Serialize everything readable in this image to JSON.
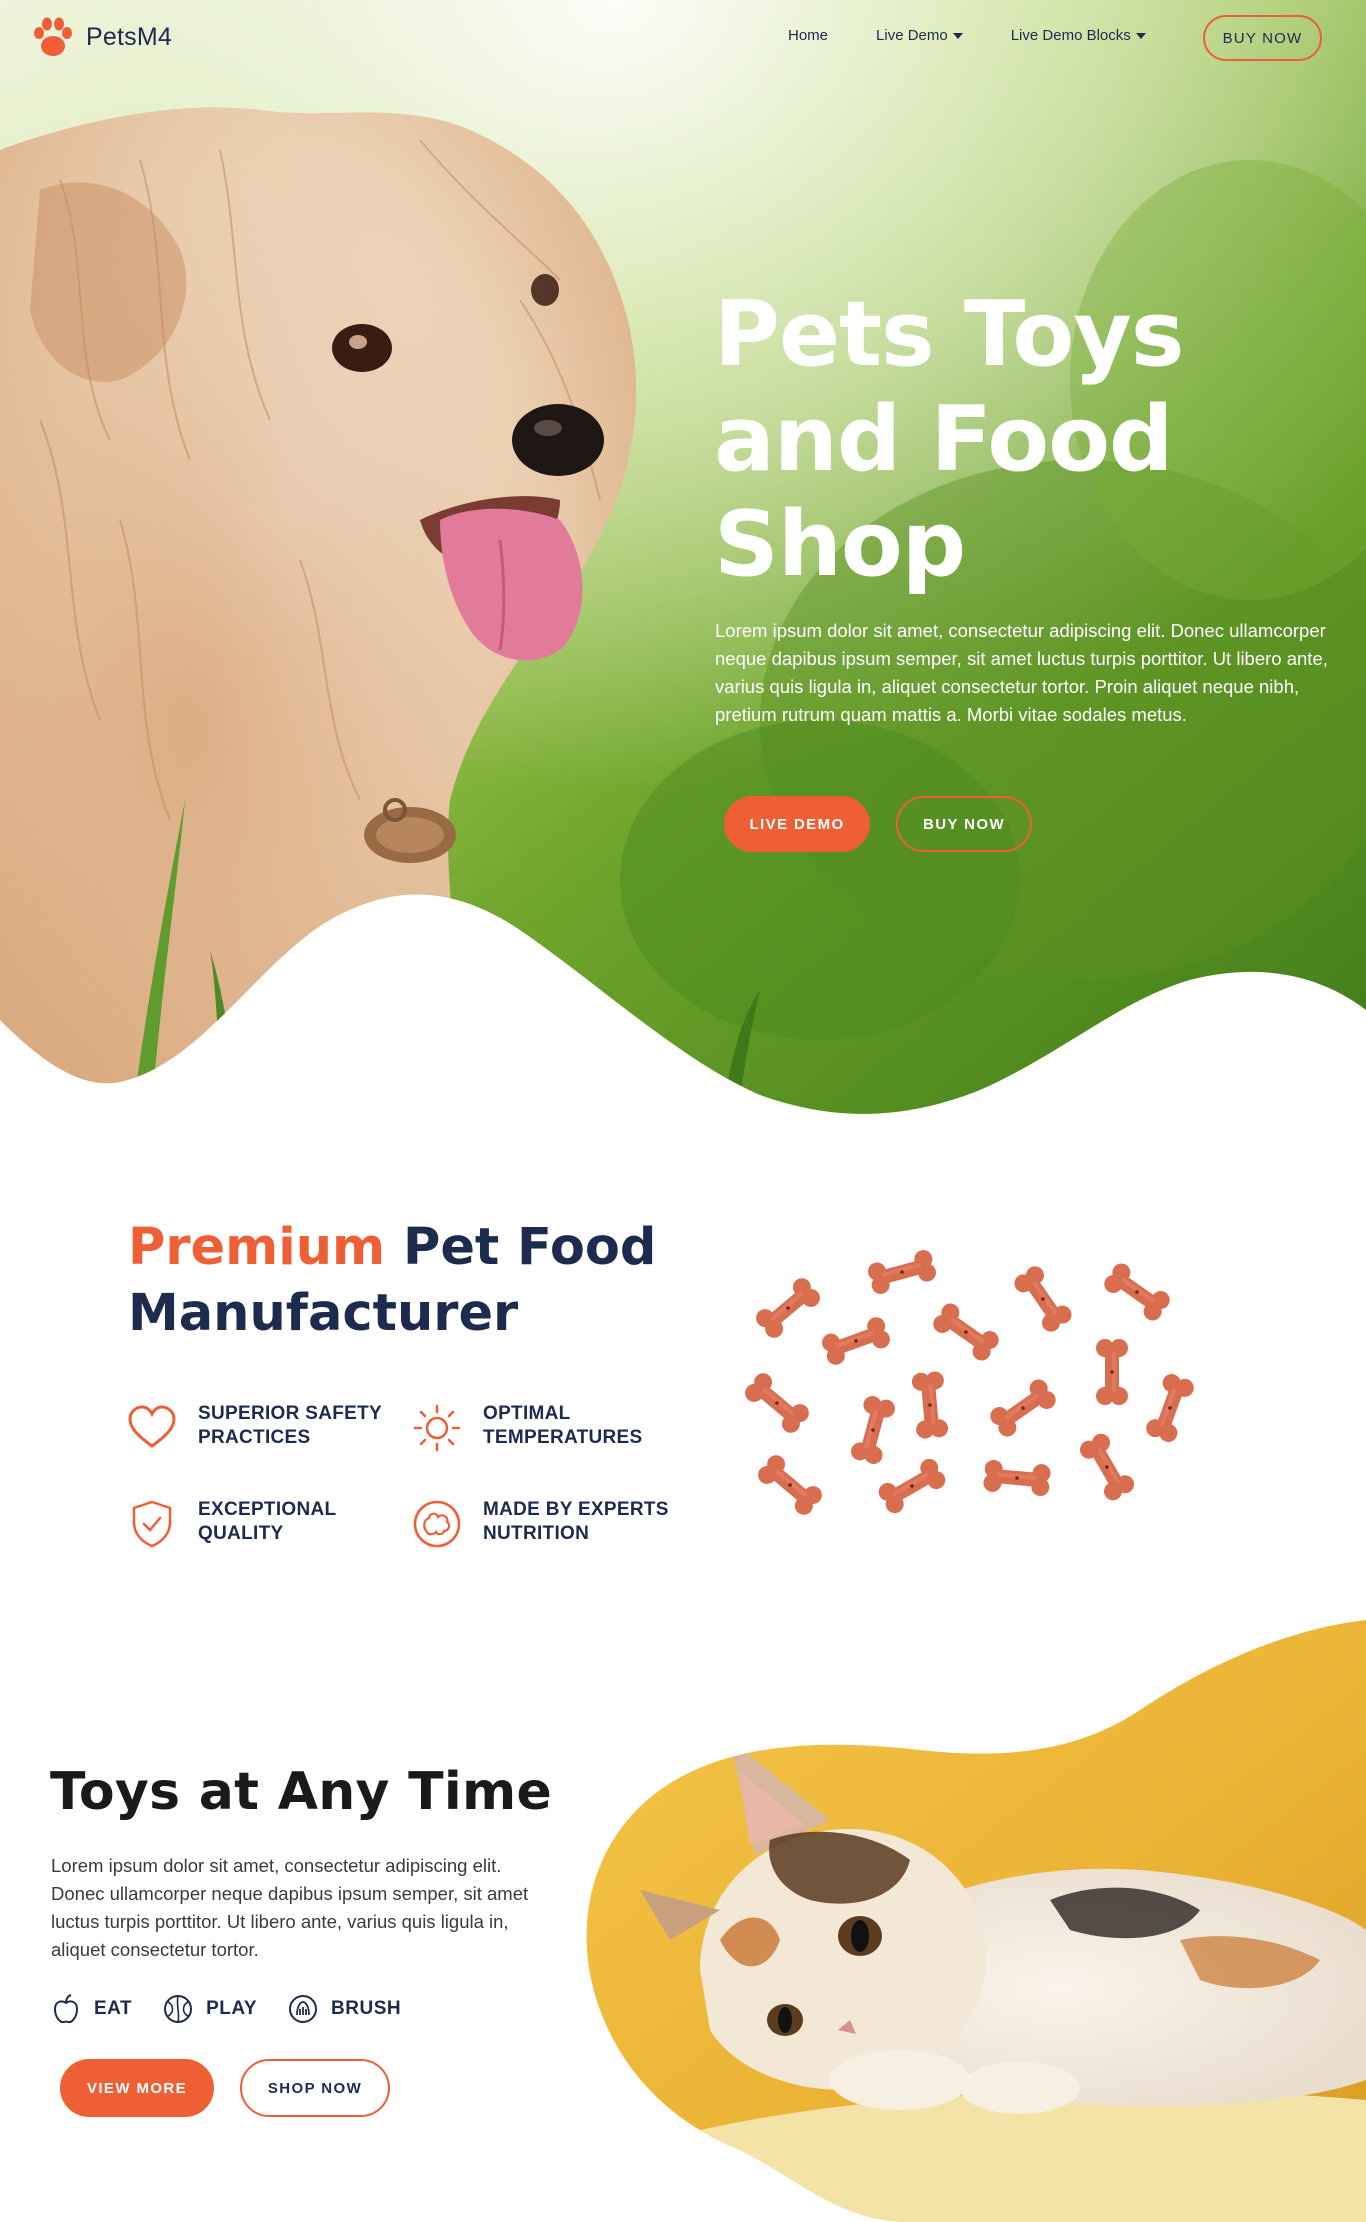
{
  "brand": {
    "name": "PetsM4",
    "accent_color": "#ee5f36",
    "text_color": "#1d2b4f",
    "logo_icon": "paw-icon"
  },
  "nav": {
    "items": [
      {
        "label": "Home",
        "has_dropdown": false
      },
      {
        "label": "Live Demo",
        "has_dropdown": true
      },
      {
        "label": "Live Demo Blocks",
        "has_dropdown": true
      }
    ],
    "cta_label": "BUY NOW"
  },
  "hero": {
    "title_lines": [
      "Pets Toys",
      "and Food",
      "Shop"
    ],
    "description": "Lorem ipsum dolor sit amet, consectetur adipiscing elit. Donec ullamcorper neque dapibus ipsum semper, sit amet luctus turpis porttitor. Ut libero ante, varius quis ligula in, aliquet consectetur tortor. Proin aliquet neque nibh, pretium rutrum quam mattis a. Morbi vitae sodales metus.",
    "primary_button": "LIVE DEMO",
    "secondary_button": "BUY NOW"
  },
  "premium": {
    "title_accent": "Premium",
    "title_rest": " Pet Food Manufacturer",
    "features": [
      {
        "icon": "heart-icon",
        "label": "SUPERIOR SAFETY\nPRACTICES"
      },
      {
        "icon": "sun-icon",
        "label": "OPTIMAL\nTEMPERATURES"
      },
      {
        "icon": "shield-check-icon",
        "label": "EXCEPTIONAL\nQUALITY"
      },
      {
        "icon": "brain-icon",
        "label": "MADE BY EXPERTS\nNUTRITION"
      }
    ]
  },
  "toys": {
    "title": "Toys at Any Time",
    "description": "Lorem ipsum dolor sit amet, consectetur adipiscing elit. Donec ullamcorper neque dapibus ipsum semper, sit amet luctus turpis porttitor. Ut libero ante, varius quis ligula in, aliquet consectetur tortor.",
    "tags": [
      {
        "icon": "apple-icon",
        "label": "EAT"
      },
      {
        "icon": "ball-icon",
        "label": "PLAY"
      },
      {
        "icon": "brush-icon",
        "label": "BRUSH"
      }
    ],
    "primary_button": "VIEW MORE",
    "secondary_button": "SHOP NOW"
  }
}
